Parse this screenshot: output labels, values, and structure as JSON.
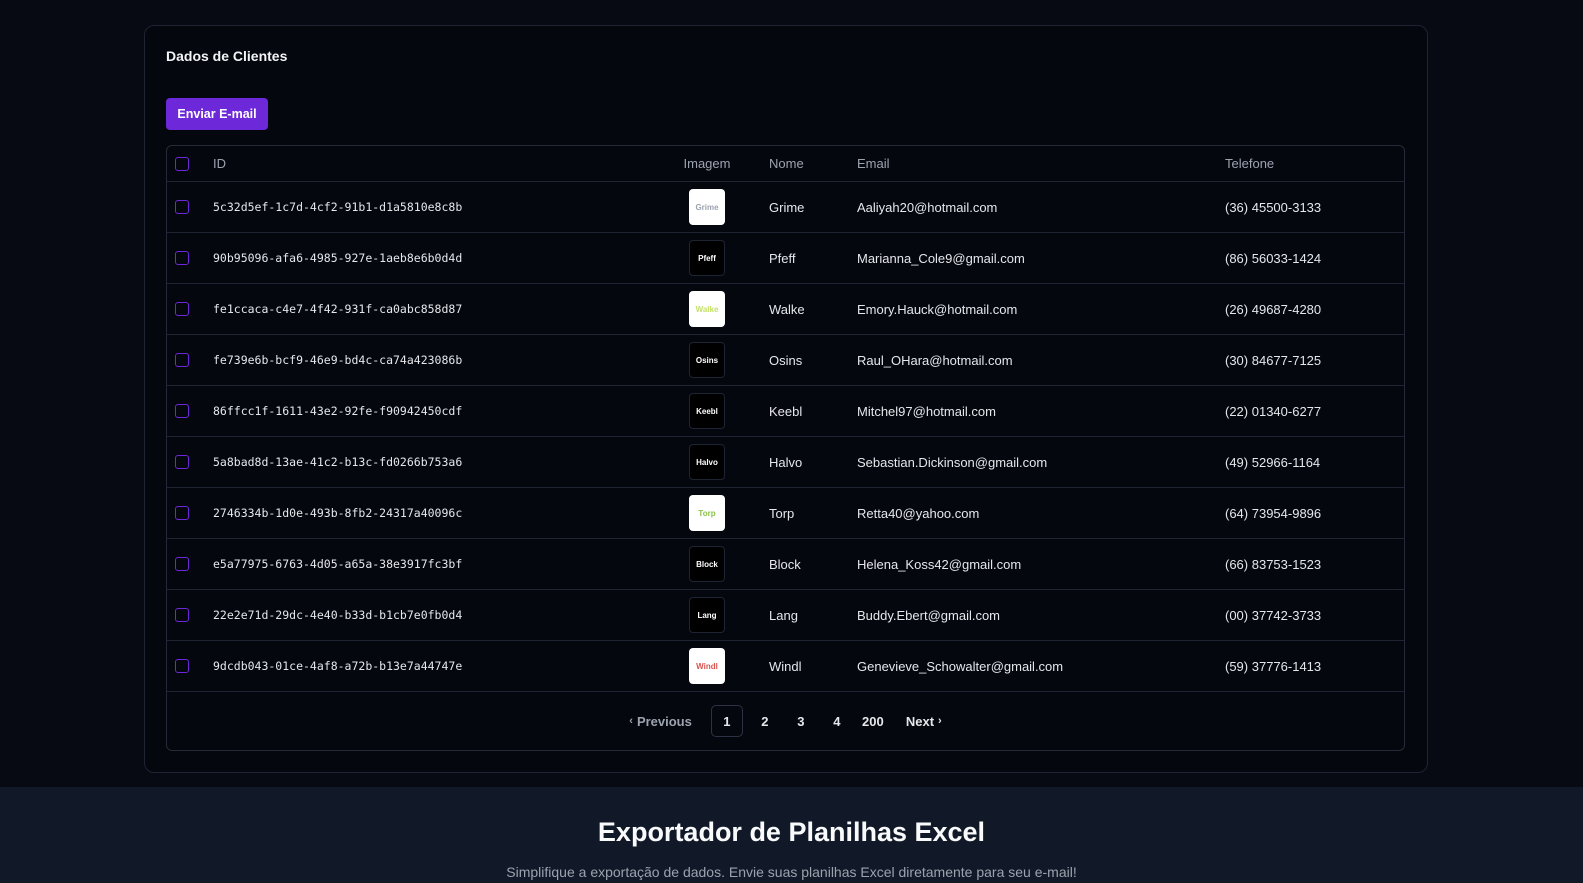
{
  "card": {
    "title": "Dados de Clientes",
    "send_button": "Enviar E-mail"
  },
  "table": {
    "headers": {
      "id": "ID",
      "image": "Imagem",
      "name": "Nome",
      "email": "Email",
      "phone": "Telefone"
    },
    "rows": [
      {
        "id": "5c32d5ef-1c7d-4cf2-91b1-d1a5810e8c8b",
        "img_text": "Grime",
        "img_bg": "#ffffff",
        "img_fg": "#9ca3af",
        "name": "Grime",
        "email": "Aaliyah20@hotmail.com",
        "phone": "(36) 45500-3133"
      },
      {
        "id": "90b95096-afa6-4985-927e-1aeb8e6b0d4d",
        "img_text": "Pfeff",
        "img_bg": "#000000",
        "img_fg": "#ffffff",
        "name": "Pfeff",
        "email": "Marianna_Cole9@gmail.com",
        "phone": "(86) 56033-1424"
      },
      {
        "id": "fe1ccaca-c4e7-4f42-931f-ca0abc858d87",
        "img_text": "Walke",
        "img_bg": "#ffffff",
        "img_fg": "#c5e06b",
        "name": "Walke",
        "email": "Emory.Hauck@hotmail.com",
        "phone": "(26) 49687-4280"
      },
      {
        "id": "fe739e6b-bcf9-46e9-bd4c-ca74a423086b",
        "img_text": "Osins",
        "img_bg": "#000000",
        "img_fg": "#ffffff",
        "name": "Osins",
        "email": "Raul_OHara@hotmail.com",
        "phone": "(30) 84677-7125"
      },
      {
        "id": "86ffcc1f-1611-43e2-92fe-f90942450cdf",
        "img_text": "Keebl",
        "img_bg": "#000000",
        "img_fg": "#ffffff",
        "name": "Keebl",
        "email": "Mitchel97@hotmail.com",
        "phone": "(22) 01340-6277"
      },
      {
        "id": "5a8bad8d-13ae-41c2-b13c-fd0266b753a6",
        "img_text": "Halvo",
        "img_bg": "#000000",
        "img_fg": "#ffffff",
        "name": "Halvo",
        "email": "Sebastian.Dickinson@gmail.com",
        "phone": "(49) 52966-1164"
      },
      {
        "id": "2746334b-1d0e-493b-8fb2-24317a40096c",
        "img_text": "Torp",
        "img_bg": "#ffffff",
        "img_fg": "#8bc34a",
        "name": "Torp",
        "email": "Retta40@yahoo.com",
        "phone": "(64) 73954-9896"
      },
      {
        "id": "e5a77975-6763-4d05-a65a-38e3917fc3bf",
        "img_text": "Block",
        "img_bg": "#000000",
        "img_fg": "#ffffff",
        "name": "Block",
        "email": "Helena_Koss42@gmail.com",
        "phone": "(66) 83753-1523"
      },
      {
        "id": "22e2e71d-29dc-4e40-b33d-b1cb7e0fb0d4",
        "img_text": "Lang",
        "img_bg": "#000000",
        "img_fg": "#ffffff",
        "name": "Lang",
        "email": "Buddy.Ebert@gmail.com",
        "phone": "(00) 37742-3733"
      },
      {
        "id": "9dcdb043-01ce-4af8-a72b-b13e7a44747e",
        "img_text": "Windl",
        "img_bg": "#ffffff",
        "img_fg": "#d9534f",
        "name": "Windl",
        "email": "Genevieve_Schowalter@gmail.com",
        "phone": "(59) 37776-1413"
      }
    ]
  },
  "pagination": {
    "previous": "Previous",
    "pages": [
      "1",
      "2",
      "3",
      "4",
      "200"
    ],
    "active": "1",
    "next": "Next"
  },
  "footer": {
    "title": "Exportador de Planilhas Excel",
    "subtitle": "Simplifique a exportação de dados. Envie suas planilhas Excel diretamente para seu e-mail!"
  },
  "colors": {
    "accent": "#6d28d9",
    "background": "#070913",
    "footer_bg": "#111827"
  }
}
